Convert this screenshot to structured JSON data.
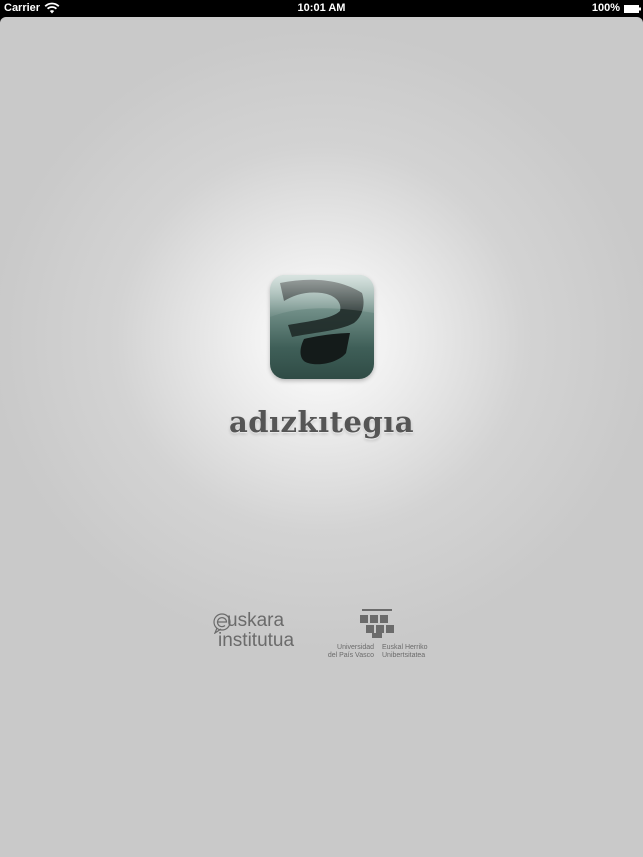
{
  "status_bar": {
    "carrier": "Carrier",
    "time": "10:01 AM",
    "battery": "100%",
    "wifi_icon": "wifi-icon",
    "battery_icon": "battery-icon"
  },
  "splash": {
    "app_icon": "letter-a-icon",
    "title": "adızkıtegıa"
  },
  "logos": {
    "euskara_line1": "uskara",
    "euskara_line2": "institutua",
    "upv_left_line1": "Universidad",
    "upv_left_line2": "del País Vasco",
    "upv_right_line1": "Euskal Herriko",
    "upv_right_line2": "Unibertsitatea"
  },
  "colors": {
    "status_bar": "#000000",
    "background_center": "#ffffff",
    "background_edge": "#c9c9c9",
    "icon_green": "#3f5f58",
    "title_gray": "#555555",
    "logo_gray": "#6b6b6b"
  }
}
